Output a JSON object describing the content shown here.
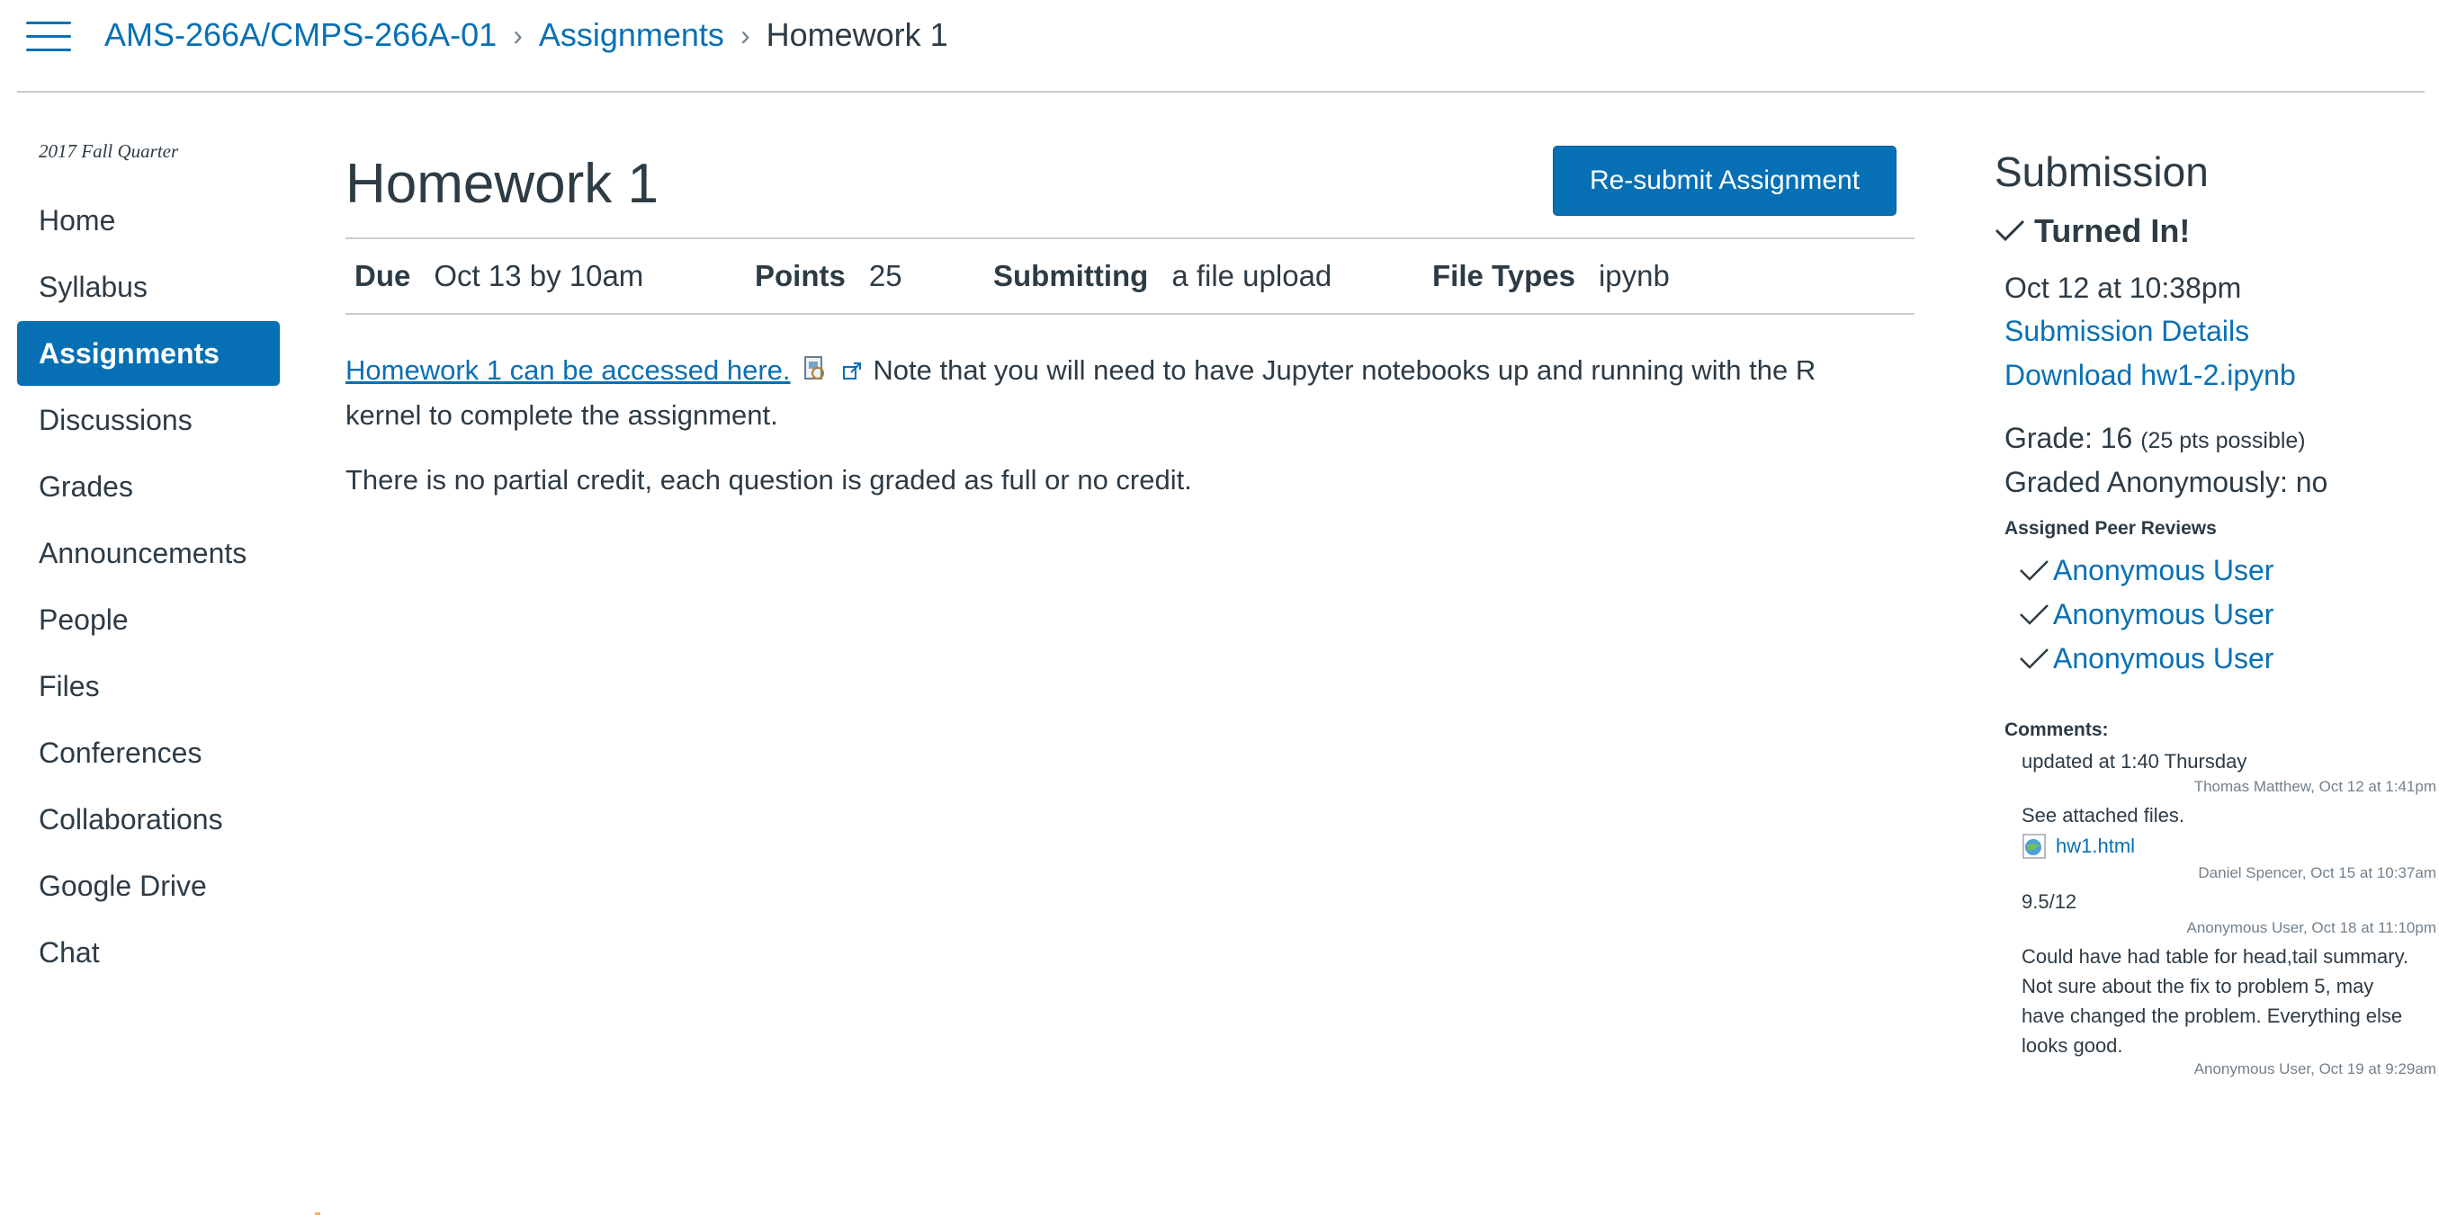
{
  "breadcrumb": {
    "course": "AMS-266A/CMPS-266A-01",
    "section": "Assignments",
    "current": "Homework 1"
  },
  "course_nav": {
    "term": "2017 Fall Quarter",
    "items": [
      {
        "label": "Home"
      },
      {
        "label": "Syllabus"
      },
      {
        "label": "Assignments",
        "active": true
      },
      {
        "label": "Discussions"
      },
      {
        "label": "Grades"
      },
      {
        "label": "Announcements"
      },
      {
        "label": "People"
      },
      {
        "label": "Files"
      },
      {
        "label": "Conferences"
      },
      {
        "label": "Collaborations"
      },
      {
        "label": "Google Drive"
      },
      {
        "label": "Chat"
      }
    ]
  },
  "assignment": {
    "title": "Homework 1",
    "resubmit_label": "Re-submit Assignment",
    "due_label": "Due",
    "due_value": "Oct 13 by 10am",
    "points_label": "Points",
    "points_value": "25",
    "submitting_label": "Submitting",
    "submitting_value": "a file upload",
    "file_types_label": "File Types",
    "file_types_value": "ipynb",
    "link_text": "Homework 1 can be accessed here.",
    "para1_rest_line1": "Note that you will need to have Jupyter notebooks up and running with the R",
    "para1_rest_line2": "kernel to complete the assignment.",
    "para2": "There is no partial credit, each question is graded as full or no credit."
  },
  "submission": {
    "heading": "Submission",
    "status": "Turned In!",
    "submitted_at": "Oct 12 at 10:38pm",
    "details_link": "Submission Details",
    "download_link": "Download hw1-2.ipynb",
    "grade_label": "Grade: 16",
    "grade_possible": "(25 pts possible)",
    "graded_anonymously": "Graded Anonymously: no",
    "peer_reviews_heading": "Assigned Peer Reviews",
    "peer_reviews": [
      "Anonymous User",
      "Anonymous User",
      "Anonymous User"
    ],
    "comments_heading": "Comments:",
    "comments": [
      {
        "text": "updated at 1:40 Thursday",
        "meta": "Thomas Matthew, Oct 12 at 1:41pm"
      },
      {
        "text": "See attached files.",
        "attachment": "hw1.html",
        "meta": "Daniel Spencer, Oct 15 at 10:37am"
      },
      {
        "text": "9.5/12",
        "meta": "Anonymous User, Oct 18 at 11:10pm"
      },
      {
        "text_lines": [
          "Could have had table for head,tail summary.",
          "Not sure about the fix to problem 5, may",
          "have changed the problem. Everything else",
          "looks good."
        ],
        "meta": "Anonymous User, Oct 19 at 9:29am"
      }
    ]
  },
  "colors": {
    "accent": "#0770b5",
    "text": "#2d3b45",
    "muted": "#73818c",
    "divider": "#c7cdd1"
  }
}
